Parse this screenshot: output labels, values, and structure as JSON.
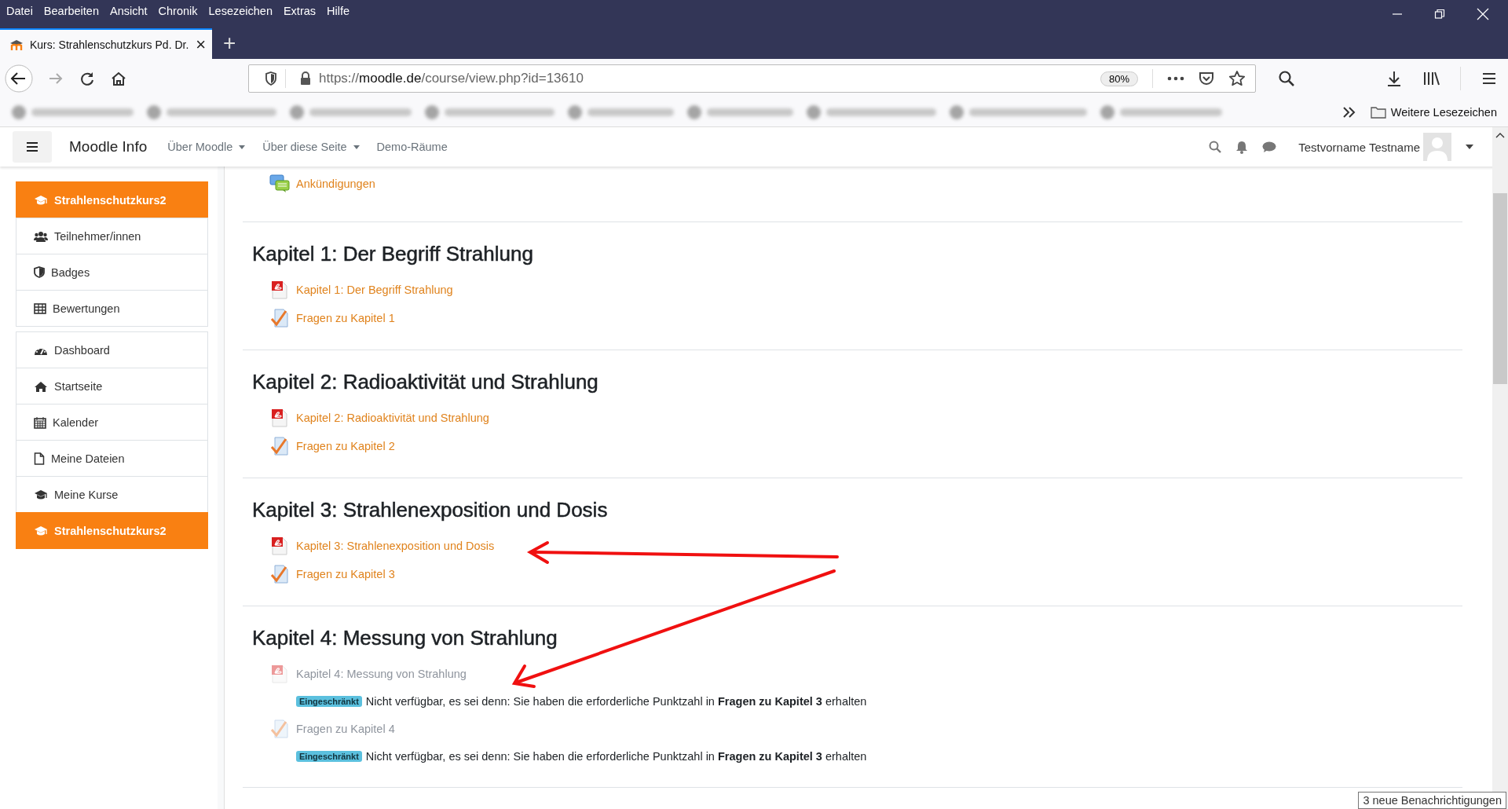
{
  "browser": {
    "menu": [
      "Datei",
      "Bearbeiten",
      "Ansicht",
      "Chronik",
      "Lesezeichen",
      "Extras",
      "Hilfe"
    ],
    "tab": {
      "title": "Kurs: Strahlenschutzkurs Pd. Dr.",
      "close": "×"
    },
    "new_tab": "+",
    "url": {
      "scheme": "https://",
      "host": "moodle.de",
      "path": "/course/view.php?id=13610"
    },
    "zoom": "80%",
    "bookmarks_more": "Weitere Lesezeichen"
  },
  "navbar": {
    "brand": "Moodle Info",
    "menus": [
      {
        "label": "Über Moodle",
        "dropdown": true
      },
      {
        "label": "Über diese Seite",
        "dropdown": true
      },
      {
        "label": "Demo-Räume",
        "dropdown": false
      }
    ],
    "user": "Testvorname Testname"
  },
  "sidebar": {
    "groups": [
      [
        {
          "label": "Strahlenschutzkurs2",
          "selected": true
        },
        {
          "label": "Teilnehmer/innen",
          "selected": false
        },
        {
          "label": "Badges",
          "selected": false
        },
        {
          "label": "Bewertungen",
          "selected": false
        }
      ],
      [
        {
          "label": "Dashboard",
          "selected": false
        },
        {
          "label": "Startseite",
          "selected": false
        },
        {
          "label": "Kalender",
          "selected": false
        },
        {
          "label": "Meine Dateien",
          "selected": false
        },
        {
          "label": "Meine Kurse",
          "selected": false
        },
        {
          "label": "Strahlenschutzkurs2",
          "selected": true
        }
      ]
    ]
  },
  "sections": [
    {
      "activities": [
        {
          "kind": "forum",
          "label": "Ankündigungen",
          "disabled": false
        }
      ]
    },
    {
      "title": "Kapitel 1: Der Begriff Strahlung",
      "activities": [
        {
          "kind": "pdf",
          "label": "Kapitel 1: Der Begriff Strahlung",
          "disabled": false
        },
        {
          "kind": "quiz",
          "label": "Fragen zu Kapitel 1",
          "disabled": false
        }
      ]
    },
    {
      "title": "Kapitel 2: Radioaktivität und Strahlung",
      "activities": [
        {
          "kind": "pdf",
          "label": "Kapitel 2: Radioaktivität und Strahlung",
          "disabled": false
        },
        {
          "kind": "quiz",
          "label": "Fragen zu Kapitel 2",
          "disabled": false
        }
      ]
    },
    {
      "title": "Kapitel 3: Strahlenexposition und Dosis",
      "activities": [
        {
          "kind": "pdf",
          "label": "Kapitel 3: Strahlenexposition und Dosis",
          "disabled": false
        },
        {
          "kind": "quiz",
          "label": "Fragen zu Kapitel 3",
          "disabled": false
        }
      ]
    },
    {
      "title": "Kapitel 4: Messung von Strahlung",
      "activities": [
        {
          "kind": "pdf",
          "label": "Kapitel 4: Messung von Strahlung",
          "disabled": true,
          "restriction": {
            "badge": "Eingeschränkt",
            "text": "Nicht verfügbar, es sei denn: Sie haben die erforderliche Punktzahl in **Fragen zu Kapitel 3** erhalten"
          }
        },
        {
          "kind": "quiz",
          "label": "Fragen zu Kapitel 4",
          "disabled": true,
          "restriction": {
            "badge": "Eingeschränkt",
            "text": "Nicht verfügbar, es sei denn: Sie haben die erforderliche Punktzahl in **Fragen zu Kapitel 3** erhalten"
          }
        }
      ]
    }
  ],
  "notification": "3 neue Benachrichtigungen"
}
